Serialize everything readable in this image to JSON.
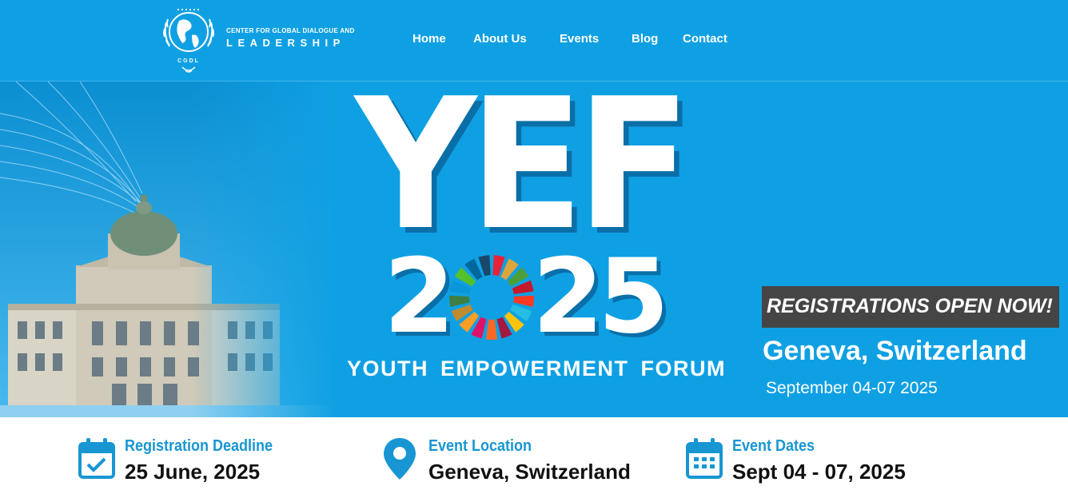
{
  "brand": {
    "emblem_initials": "CGDL",
    "line1": "CENTER FOR GLOBAL DIALOGUE AND",
    "line2": "LEADERSHIP"
  },
  "nav": [
    {
      "label": "Home"
    },
    {
      "label": "About Us"
    },
    {
      "label": "Events"
    },
    {
      "label": "Blog"
    },
    {
      "label": "Contact"
    }
  ],
  "hero": {
    "acronym": "YEF",
    "year_digits": [
      "2",
      "2",
      "5"
    ],
    "forum_name": "YOUTH EMPOWERMENT FORUM",
    "registration_banner": "REGISTRATIONS OPEN NOW!",
    "city": "Geneva, Switzerland",
    "dates": "September 04-07 2025",
    "sdg_colors": [
      "#e5243b",
      "#dda63a",
      "#4c9f38",
      "#c5192d",
      "#ff3a21",
      "#26bde2",
      "#fcc30b",
      "#a21942",
      "#fd6925",
      "#dd1367",
      "#fd9d24",
      "#bf8b2e",
      "#3f7e44",
      "#0a97d9",
      "#56c02b",
      "#00689d",
      "#19486a"
    ]
  },
  "info": [
    {
      "icon": "calendar-check-icon",
      "label": "Registration Deadline",
      "value": "25 June, 2025"
    },
    {
      "icon": "map-pin-icon",
      "label": "Event Location",
      "value": "Geneva, Switzerland"
    },
    {
      "icon": "calendar-grid-icon",
      "label": "Event Dates",
      "value": "Sept 04 - 07, 2025"
    }
  ],
  "colors": {
    "primary_blue": "#0fa0e3",
    "label_blue": "#1796d3",
    "banner_gray": "#454545"
  }
}
